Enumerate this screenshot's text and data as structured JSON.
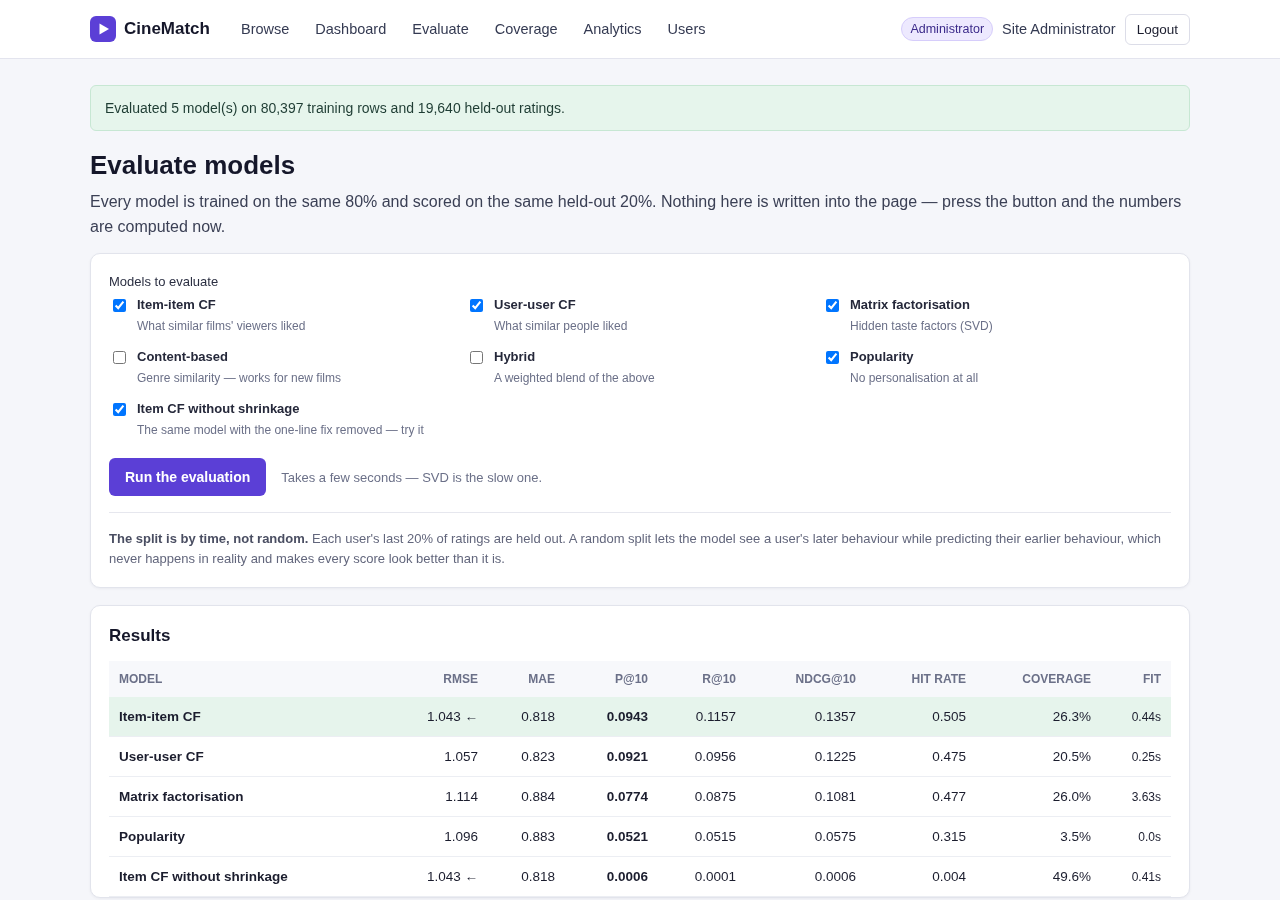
{
  "header": {
    "brand": "CineMatch",
    "nav": [
      "Browse",
      "Dashboard",
      "Evaluate",
      "Coverage",
      "Analytics",
      "Users"
    ],
    "role_badge": "Administrator",
    "user_name": "Site Administrator",
    "logout_button": "Logout"
  },
  "alert": {
    "text": "Evaluated 5 model(s) on 80,397 training rows and 19,640 held-out ratings."
  },
  "page": {
    "title": "Evaluate models",
    "intro": "Every model is trained on the same 80% and scored on the same held-out 20%. Nothing here is written into the page — press the button and the numbers are computed now."
  },
  "model_picker": {
    "label": "Models to evaluate",
    "models": [
      {
        "name": "Item-item CF",
        "description": "What similar films' viewers liked",
        "checked": true
      },
      {
        "name": "User-user CF",
        "description": "What similar people liked",
        "checked": true
      },
      {
        "name": "Matrix factorisation",
        "description": "Hidden taste factors (SVD)",
        "checked": true
      },
      {
        "name": "Content-based",
        "description": "Genre similarity — works for new films",
        "checked": false
      },
      {
        "name": "Hybrid",
        "description": "A weighted blend of the above",
        "checked": false
      },
      {
        "name": "Popularity",
        "description": "No personalisation at all",
        "checked": true
      },
      {
        "name": "Item CF without shrinkage",
        "description": "The same model with the one-line fix removed — try it",
        "checked": true
      }
    ],
    "run_button": "Run the evaluation",
    "run_hint": "Takes a few seconds — SVD is the slow one.",
    "note": "**The split is by time, not random.** Each user's last 20% of ratings are held out. A random split lets the model see a user's later behaviour while predicting their earlier behaviour, which never happens in reality and makes every score look better than it is."
  },
  "results": {
    "title": "Results",
    "columns": [
      {
        "label": "MODEL",
        "kind": "text"
      },
      {
        "label": "RMSE",
        "kind": "number"
      },
      {
        "label": "MAE",
        "kind": "number"
      },
      {
        "label": "P@10",
        "kind": "strong"
      },
      {
        "label": "R@10",
        "kind": "number"
      },
      {
        "label": "NDCG@10",
        "kind": "number"
      },
      {
        "label": "HIT RATE",
        "kind": "number"
      },
      {
        "label": "COVERAGE",
        "kind": "number"
      },
      {
        "label": "FIT",
        "kind": "small"
      }
    ],
    "rows": [
      {
        "highlighted": true,
        "cells": [
          "Item-item CF",
          "1.043 ←",
          "0.818",
          "0.0943",
          "0.1157",
          "0.1357",
          "0.505",
          "26.3%",
          "0.44s"
        ]
      },
      {
        "highlighted": false,
        "cells": [
          "User-user CF",
          "1.057",
          "0.823",
          "0.0921",
          "0.0956",
          "0.1225",
          "0.475",
          "20.5%",
          "0.25s"
        ]
      },
      {
        "highlighted": false,
        "cells": [
          "Matrix factorisation",
          "1.114",
          "0.884",
          "0.0774",
          "0.0875",
          "0.1081",
          "0.477",
          "26.0%",
          "3.63s"
        ]
      },
      {
        "highlighted": false,
        "cells": [
          "Popularity",
          "1.096",
          "0.883",
          "0.0521",
          "0.0515",
          "0.0575",
          "0.315",
          "3.5%",
          "0.0s"
        ]
      },
      {
        "highlighted": false,
        "cells": [
          "Item CF without shrinkage",
          "1.043 ←",
          "0.818",
          "0.0006",
          "0.0001",
          "0.0006",
          "0.004",
          "49.6%",
          "0.41s"
        ]
      }
    ]
  }
}
